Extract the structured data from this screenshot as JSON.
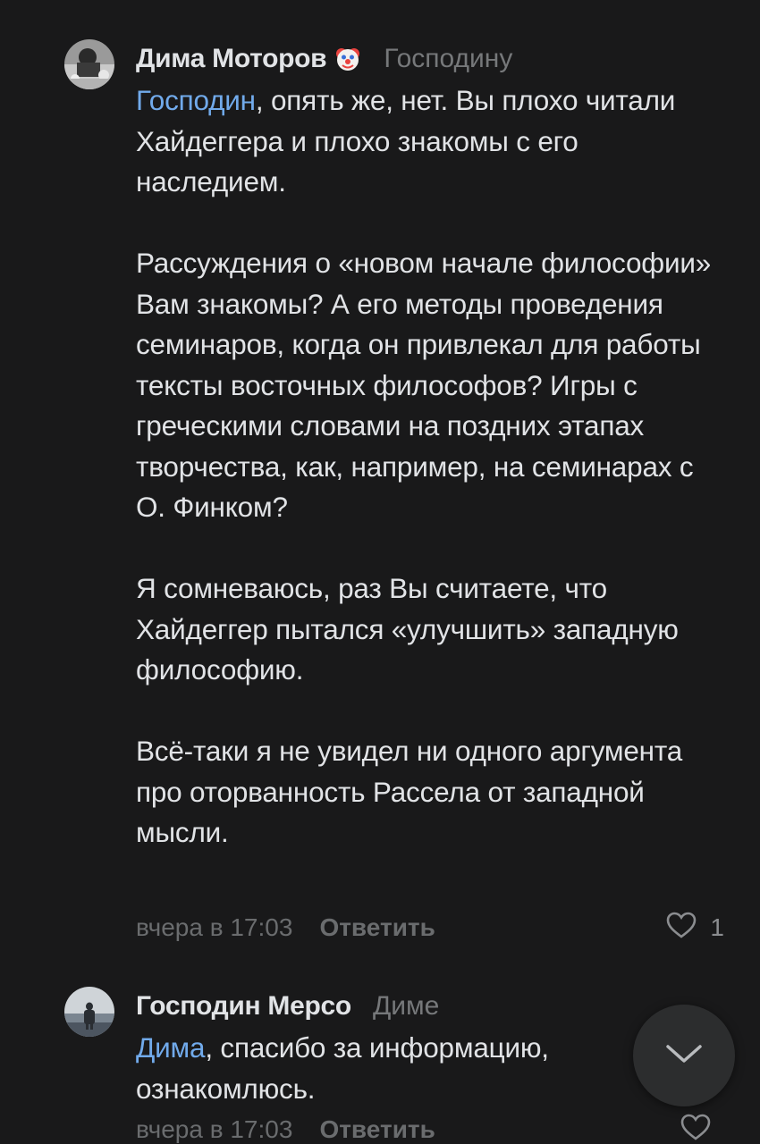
{
  "comments": [
    {
      "author": "Дима Моторов",
      "author_emoji_icon": "clown-face-icon",
      "reply_to": "Господину",
      "mention": "Господин",
      "paragraphs": [
        ", опять же, нет. Вы плохо читали Хайдеггера и плохо знакомы с его наследием.",
        "Рассуждения о «новом начале философии» Вам знакомы? А его методы проведения семинаров, когда он привлекал для работы тексты восточных философов? Игры с греческими словами на поздних этапах творчества, как, например, на семинарах с О. Финком?",
        "Я сомневаюсь, раз Вы считаете, что Хайдеггер пытался «улучшить» западную философию.",
        "Всё-таки я не увидел ни одного аргумента про оторванность Рассела от западной мысли."
      ],
      "time": "вчера в 17:03",
      "reply_label": "Ответить",
      "likes": "1"
    },
    {
      "author": "Господин Мерсо",
      "reply_to": "Диме",
      "mention": "Дима",
      "paragraphs": [
        ", спасибо за информацию, ознакомлюсь."
      ],
      "time": "вчера в 17:03",
      "reply_label": "Ответить",
      "likes": ""
    }
  ],
  "colors": {
    "background": "#19191a",
    "text": "#e1e3e6",
    "secondary": "#76787a",
    "link": "#71aaeb"
  },
  "scroll_button_icon": "chevron-down-icon"
}
